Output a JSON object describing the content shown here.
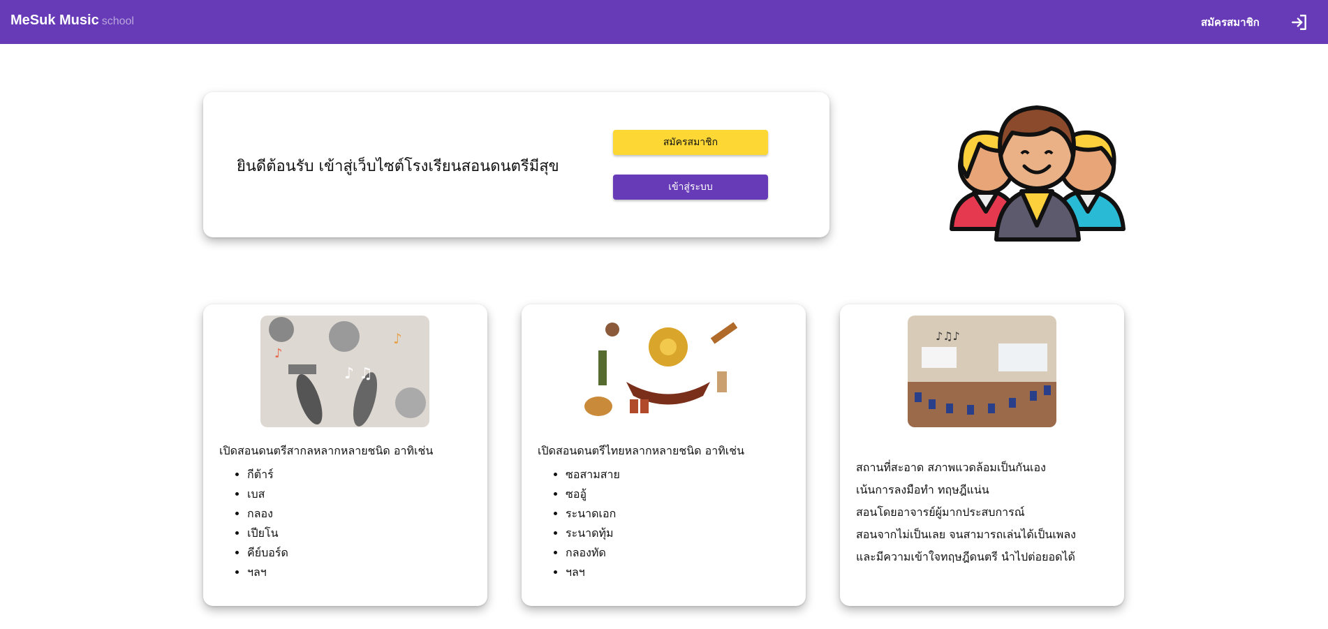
{
  "header": {
    "brand": "MeSuk Music",
    "brand_sub": "school",
    "register_link": "สมัครสมาชิก",
    "login_icon": "login-icon",
    "bg_color": "#673ab7"
  },
  "welcome": {
    "title": "ยินดีต้อนรับ เข้าสู่เว็บไซต์โรงเรียนสอนดนตรีมีสุข",
    "register_button": "สมัครสมาชิก",
    "login_button": "เข้าสู่ระบบ",
    "register_color": "#fdd835",
    "login_color": "#673ab7"
  },
  "hero": {
    "icon": "group-of-people-icon"
  },
  "features": [
    {
      "intro": "เปิดสอนดนตรีสากลหลากหลายชนิด อาทิเช่น",
      "items": [
        "กีต้าร์",
        "เบส",
        "กลอง",
        "เปียโน",
        "คีย์บอร์ด",
        "ฯลฯ"
      ]
    },
    {
      "intro": "เปิดสอนดนตรีไทยหลากหลายชนิด อาทิเช่น",
      "items": [
        "ซอสามสาย",
        "ซออู้",
        "ระนาดเอก",
        "ระนาดทุ้ม",
        "กลองทัด",
        "ฯลฯ"
      ]
    },
    {
      "lines": [
        "สถานที่สะอาด สภาพแวดล้อมเป็นกันเอง",
        "เน้นการลงมือทำ ทฤษฎีแน่น",
        "สอนโดยอาจารย์ผู้มากประสบการณ์",
        "สอนจากไม่เป็นเลย จนสามารถเล่นได้เป็นเพลง",
        "และมีความเข้าใจทฤษฎีดนตรี นำไปต่อยอดได้"
      ]
    }
  ]
}
